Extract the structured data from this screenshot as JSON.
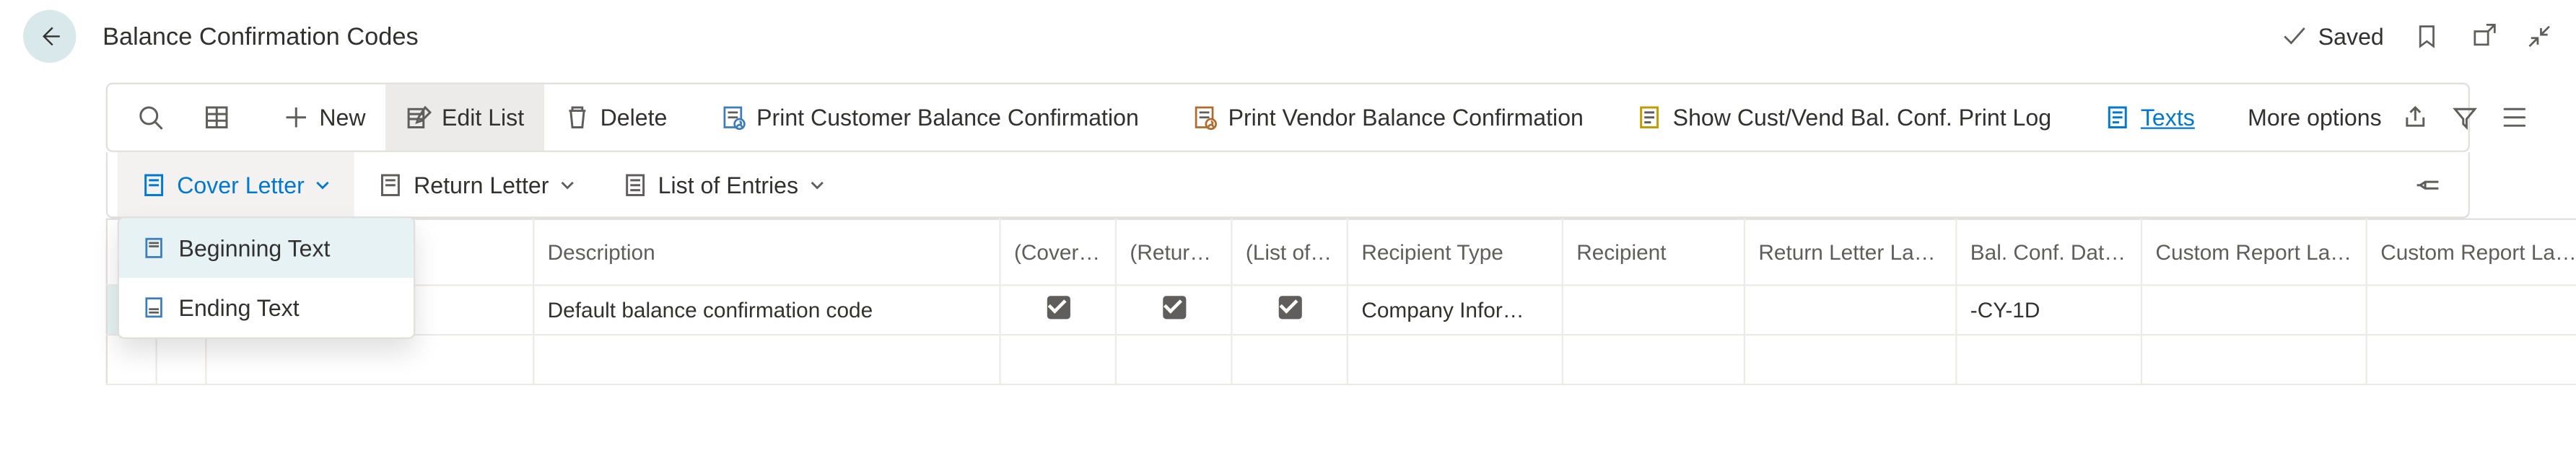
{
  "header": {
    "title": "Balance Confirmation Codes",
    "saved_label": "Saved"
  },
  "toolbar": {
    "new_label": "New",
    "edit_list_label": "Edit List",
    "delete_label": "Delete",
    "print_customer_label": "Print Customer Balance Confirmation",
    "print_vendor_label": "Print Vendor Balance Confirmation",
    "show_log_label": "Show Cust/Vend Bal. Conf. Print Log",
    "texts_label": "Texts",
    "more_options_label": "More options"
  },
  "sub_toolbar": {
    "cover_letter_label": "Cover Letter",
    "return_letter_label": "Return Letter",
    "list_of_entries_label": "List of Entries"
  },
  "dropdown": {
    "beginning_text_label": "Beginning Text",
    "ending_text_label": "Ending Text"
  },
  "columns": {
    "description": "Description",
    "cover_letter": "(Cover Letter)",
    "return_letter": "(Return Letter)",
    "list_of_entries": "(List of Entries)",
    "recipient_type": "Recipient Type",
    "recipient": "Recipient",
    "return_lang": "Return Letter Language Code",
    "date_formula": "Bal. Conf. Date Formula",
    "custom_report_1": "Custom Report Layout",
    "custom_report_2": "Custom Report Layout"
  },
  "rows": [
    {
      "description": "Default balance confirmation code",
      "recipient_type": "Company Infor…",
      "recipient": "",
      "return_lang": "",
      "date_formula": "-CY-1D",
      "custom_report_1": "",
      "custom_report_2": ""
    }
  ]
}
